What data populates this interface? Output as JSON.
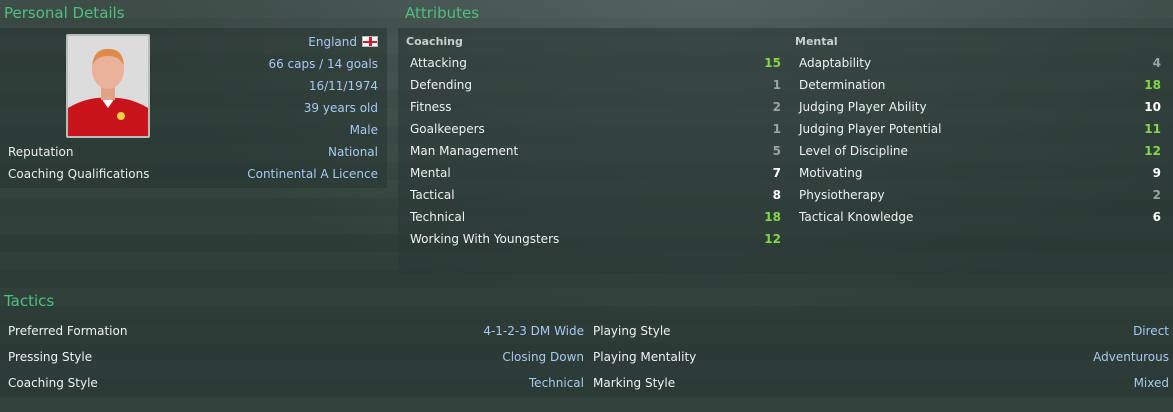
{
  "personal": {
    "title": "Personal Details",
    "nationality": "England",
    "caps": "66 caps / 14 goals",
    "dob": "16/11/1974",
    "age": "39 years old",
    "gender": "Male",
    "reputation_label": "Reputation",
    "reputation_value": "National",
    "qualifications_label": "Coaching Qualifications",
    "qualifications_value": "Continental A Licence"
  },
  "attributes": {
    "title": "Attributes",
    "coaching_header": "Coaching",
    "mental_header": "Mental",
    "coaching": [
      {
        "name": "Attacking",
        "value": "15",
        "level": "high"
      },
      {
        "name": "Defending",
        "value": "1",
        "level": "low"
      },
      {
        "name": "Fitness",
        "value": "2",
        "level": "low"
      },
      {
        "name": "Goalkeepers",
        "value": "1",
        "level": "low"
      },
      {
        "name": "Man Management",
        "value": "5",
        "level": "low"
      },
      {
        "name": "Mental",
        "value": "7",
        "level": "mid"
      },
      {
        "name": "Tactical",
        "value": "8",
        "level": "mid"
      },
      {
        "name": "Technical",
        "value": "18",
        "level": "high"
      },
      {
        "name": "Working With Youngsters",
        "value": "12",
        "level": "high"
      }
    ],
    "mental": [
      {
        "name": "Adaptability",
        "value": "4",
        "level": "low"
      },
      {
        "name": "Determination",
        "value": "18",
        "level": "high"
      },
      {
        "name": "Judging Player Ability",
        "value": "10",
        "level": "mid"
      },
      {
        "name": "Judging Player Potential",
        "value": "11",
        "level": "high"
      },
      {
        "name": "Level of Discipline",
        "value": "12",
        "level": "high"
      },
      {
        "name": "Motivating",
        "value": "9",
        "level": "mid"
      },
      {
        "name": "Physiotherapy",
        "value": "2",
        "level": "low"
      },
      {
        "name": "Tactical Knowledge",
        "value": "6",
        "level": "mid"
      }
    ]
  },
  "tactics": {
    "title": "Tactics",
    "left": [
      {
        "label": "Preferred Formation",
        "value": "4-1-2-3 DM Wide"
      },
      {
        "label": "Pressing Style",
        "value": "Closing Down"
      },
      {
        "label": "Coaching Style",
        "value": "Technical"
      }
    ],
    "right": [
      {
        "label": "Playing Style",
        "value": "Direct"
      },
      {
        "label": "Playing Mentality",
        "value": "Adventurous"
      },
      {
        "label": "Marking Style",
        "value": "Mixed"
      }
    ]
  },
  "colors": {
    "section_title": "#4fbf7d",
    "value_blue": "#a7c9f0",
    "attr_high": "#86d645",
    "attr_low": "#9aa4a2"
  }
}
